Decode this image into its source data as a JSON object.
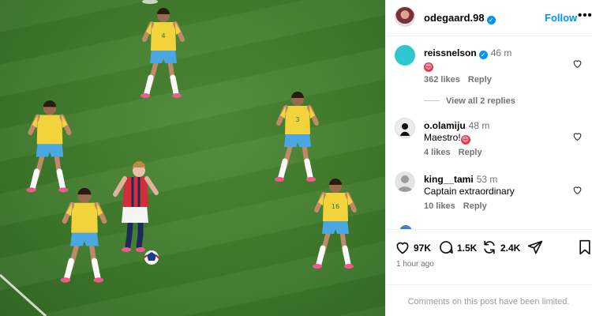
{
  "post": {
    "author": "odegaard.98",
    "follow_label": "Follow",
    "more_label": "•••",
    "verified_mark": "✓"
  },
  "photo": {
    "shirt_numbers": [
      "4",
      "3",
      "16"
    ],
    "colors": {
      "pitch": "#3f7a2c",
      "brazil_shirt": "#f2d33b",
      "brazil_shorts": "#4ba7e2",
      "norway_shirt": "#d32d3c",
      "norway_shorts": "#f5f5f5"
    }
  },
  "comments": [
    {
      "user": "reissnelson",
      "verified": true,
      "time": "46 m",
      "text": "😍",
      "likes": "362 likes",
      "reply_label": "Reply",
      "avatar_color": "#2fc7cf"
    },
    {
      "user": "o.olamiju",
      "verified": false,
      "time": "48 m",
      "text": "Maestro!",
      "emoji": "😍",
      "likes": "4 likes",
      "reply_label": "Reply",
      "avatar_color": "#e8e8e8"
    },
    {
      "user": "king__tami",
      "verified": false,
      "time": "53 m",
      "text": "Captain extraordinary",
      "likes": "10 likes",
      "reply_label": "Reply",
      "avatar_color": "#dcdcdc"
    }
  ],
  "view_replies_label": "View all 2 replies",
  "actions": {
    "likes": "97K",
    "comments": "1.5K",
    "reposts": "2.4K"
  },
  "posted_ago": "1 hour ago",
  "comments_limited_notice": "Comments on this post have been limited.",
  "icons": [
    "heart-icon",
    "comment-icon",
    "repost-icon",
    "share-icon",
    "bookmark-icon",
    "verified-icon",
    "more-icon"
  ]
}
